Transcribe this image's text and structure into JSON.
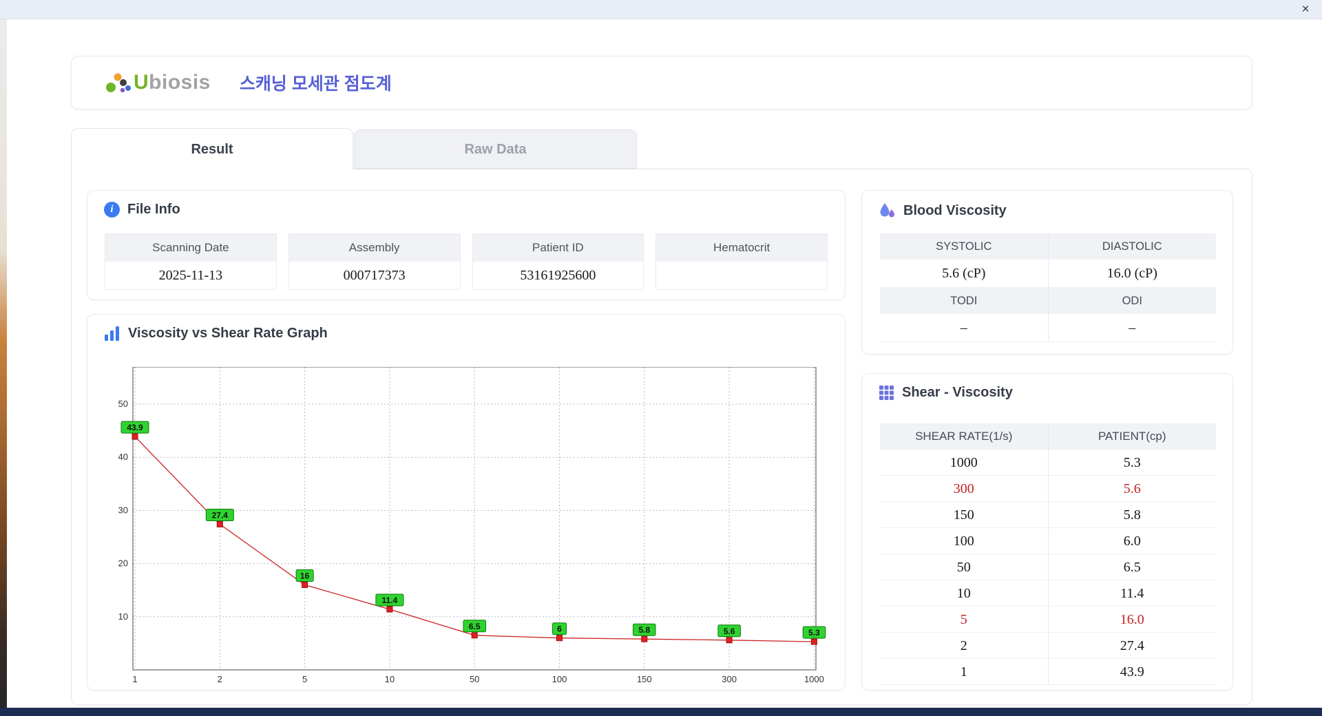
{
  "window": {
    "close_glyph": "×"
  },
  "header": {
    "logo_u": "U",
    "logo_rest": "biosis",
    "title": "스캐닝 모세관 점도계"
  },
  "tabs": [
    {
      "label": "Result",
      "active": true
    },
    {
      "label": "Raw Data",
      "active": false
    }
  ],
  "file_info": {
    "title": "File Info",
    "fields": [
      {
        "label": "Scanning Date",
        "value": "2025-11-13"
      },
      {
        "label": "Assembly",
        "value": "000717373"
      },
      {
        "label": "Patient ID",
        "value": "53161925600"
      },
      {
        "label": "Hematocrit",
        "value": ""
      }
    ]
  },
  "graph": {
    "title": "Viscosity vs Shear Rate Graph"
  },
  "chart_data": {
    "type": "line",
    "title": "Viscosity vs Shear Rate Graph",
    "x_axis_type": "category",
    "x_categories": [
      "1",
      "2",
      "5",
      "10",
      "50",
      "100",
      "150",
      "300",
      "1000"
    ],
    "values": [
      43.9,
      27.4,
      16,
      11.4,
      6.5,
      6,
      5.8,
      5.6,
      5.3
    ],
    "point_labels": [
      "43.9",
      "27.4",
      "16",
      "11.4",
      "6.5",
      "6",
      "5.8",
      "5.6",
      "5.3"
    ],
    "yticks": [
      10,
      20,
      30,
      40,
      50
    ],
    "ylim": [
      0,
      57
    ],
    "grid": "dotted",
    "line_color": "#cc2222",
    "marker_color": "#e02020",
    "marker_stroke": "#991111",
    "label_bg": "#2fd32f",
    "label_border": "#0f7a0f",
    "xlabel": "",
    "ylabel": "",
    "legend": "none"
  },
  "blood_viscosity": {
    "title": "Blood Viscosity",
    "rows": [
      {
        "header": true,
        "cells": [
          {
            "text": "SYSTOLIC"
          },
          {
            "text": "DIASTOLIC"
          }
        ]
      },
      {
        "header": false,
        "cells": [
          {
            "text": "5.6 (cP)"
          },
          {
            "text": "16.0 (cP)"
          }
        ]
      },
      {
        "header": true,
        "cells": [
          {
            "text": "TODI"
          },
          {
            "text": "ODI"
          }
        ]
      },
      {
        "header": false,
        "cells": [
          {
            "text": "–"
          },
          {
            "text": "–"
          }
        ]
      }
    ]
  },
  "shear_viscosity": {
    "title": "Shear - Viscosity",
    "columns": [
      "SHEAR RATE(1/s)",
      "PATIENT(cp)"
    ],
    "rows": [
      {
        "shear": "1000",
        "patient": "5.3",
        "highlight": false
      },
      {
        "shear": "300",
        "patient": "5.6",
        "highlight": true
      },
      {
        "shear": "150",
        "patient": "5.8",
        "highlight": false
      },
      {
        "shear": "100",
        "patient": "6.0",
        "highlight": false
      },
      {
        "shear": "50",
        "patient": "6.5",
        "highlight": false
      },
      {
        "shear": "10",
        "patient": "11.4",
        "highlight": false
      },
      {
        "shear": "5",
        "patient": "16.0",
        "highlight": true
      },
      {
        "shear": "2",
        "patient": "27.4",
        "highlight": false
      },
      {
        "shear": "1",
        "patient": "43.9",
        "highlight": false
      }
    ]
  }
}
